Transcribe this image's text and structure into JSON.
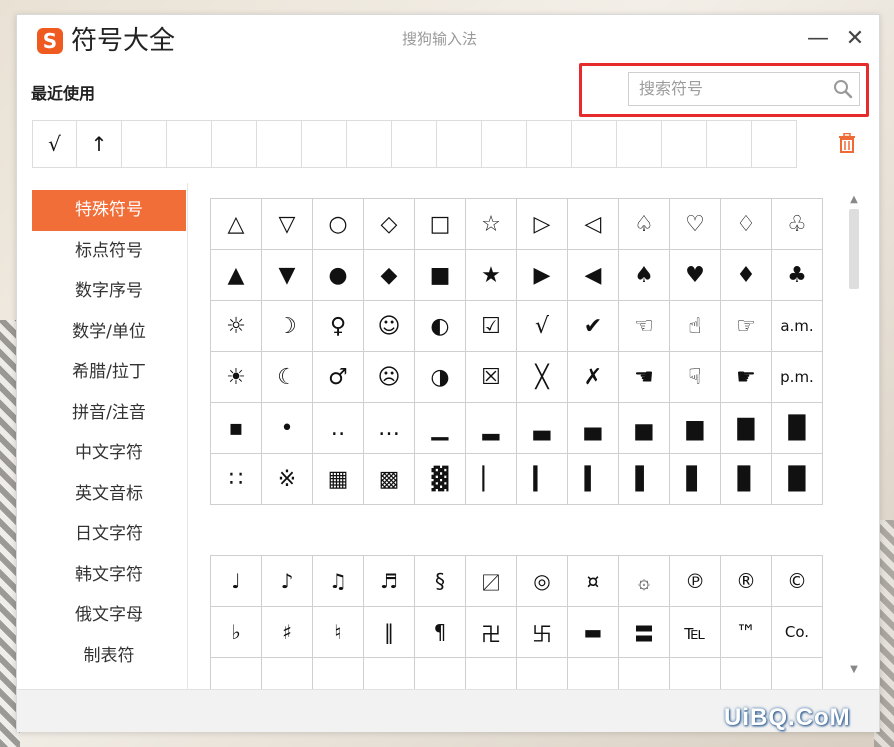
{
  "window": {
    "logo_glyph": "S",
    "title": "符号大全",
    "ime_name": "搜狗输入法",
    "minimize_glyph": "—",
    "close_glyph": "✕"
  },
  "recent": {
    "label": "最近使用",
    "symbols": [
      "√",
      "↑",
      "",
      "",
      "",
      "",
      "",
      "",
      "",
      "",
      "",
      "",
      "",
      "",
      "",
      "",
      ""
    ]
  },
  "search": {
    "placeholder": "搜索符号",
    "value": "",
    "highlight_color": "#e52b2b"
  },
  "sidebar": {
    "accent_color": "#f26e38",
    "items": [
      {
        "label": "特殊符号",
        "active": true
      },
      {
        "label": "标点符号"
      },
      {
        "label": "数字序号"
      },
      {
        "label": "数学/单位"
      },
      {
        "label": "希腊/拉丁"
      },
      {
        "label": "拼音/注音"
      },
      {
        "label": "中文字符"
      },
      {
        "label": "英文音标"
      },
      {
        "label": "日文字符"
      },
      {
        "label": "韩文字符"
      },
      {
        "label": "俄文字母"
      },
      {
        "label": "制表符"
      }
    ]
  },
  "grid1": [
    [
      "△",
      "▽",
      "○",
      "◇",
      "□",
      "☆",
      "▷",
      "◁",
      "♤",
      "♡",
      "♢",
      "♧"
    ],
    [
      "▲",
      "▼",
      "●",
      "◆",
      "■",
      "★",
      "▶",
      "◀",
      "♠",
      "♥",
      "♦",
      "♣"
    ],
    [
      "☼",
      "☽",
      "♀",
      "☺",
      "◐",
      "☑",
      "√",
      "✔",
      "☜",
      "☝",
      "☞",
      "a.m."
    ],
    [
      "☀",
      "☾",
      "♂",
      "☹",
      "◑",
      "☒",
      "╳",
      "✗",
      "☚",
      "☟",
      "☛",
      "p.m."
    ],
    [
      "▪",
      "•",
      "‥",
      "…",
      "▁",
      "▂",
      "▃",
      "▄",
      "▅",
      "▆",
      "▇",
      "█"
    ],
    [
      "∷",
      "※",
      "▦",
      "▩",
      "▓",
      "▏",
      "▎",
      "▍",
      "▌",
      "▋",
      "▊",
      "█"
    ]
  ],
  "grid2": [
    [
      "♩",
      "♪",
      "♫",
      "♬",
      "§",
      "〼",
      "◎",
      "¤",
      "۞",
      "℗",
      "®",
      "©"
    ],
    [
      "♭",
      "♯",
      "♮",
      "‖",
      "¶",
      "卍",
      "卐",
      "▬",
      "〓",
      "℡",
      "™",
      "Co."
    ],
    [
      "",
      "",
      "",
      "",
      "",
      "",
      "",
      "",
      "",
      "",
      "",
      ""
    ]
  ],
  "watermark": "UiBQ.CoM"
}
